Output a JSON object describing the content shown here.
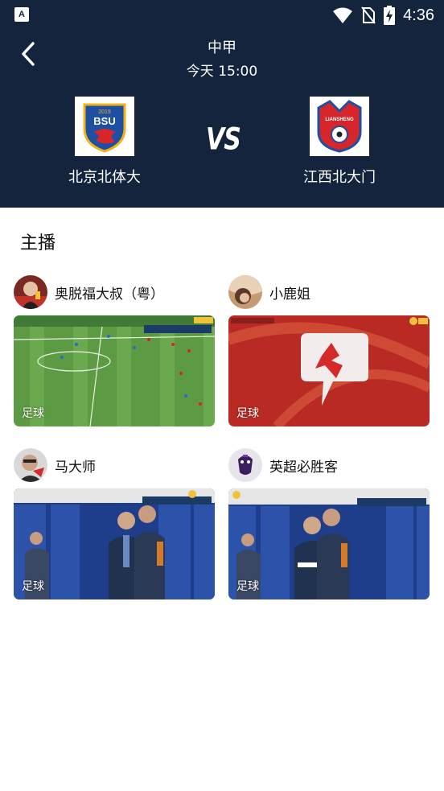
{
  "status_bar": {
    "time": "4:36",
    "app_badge": "A"
  },
  "match": {
    "league": "中甲",
    "kickoff": "今天 15:00",
    "vs_text": "VS",
    "home_team": {
      "name": "北京北体大",
      "logo_text": "BSU",
      "logo_year": "2019"
    },
    "away_team": {
      "name": "江西北大门",
      "logo_text": "LIANSHENG"
    }
  },
  "section_title": "主播",
  "anchors": [
    {
      "name": "奥脱福大叔（粤）",
      "category": "足球"
    },
    {
      "name": "小鹿姐",
      "category": "足球"
    },
    {
      "name": "马大师",
      "category": "足球"
    },
    {
      "name": "英超必胜客",
      "category": "足球"
    }
  ],
  "colors": {
    "header_bg": "#13243c",
    "home_logo_blue": "#1d4fa3",
    "away_logo_red": "#d6262b"
  }
}
